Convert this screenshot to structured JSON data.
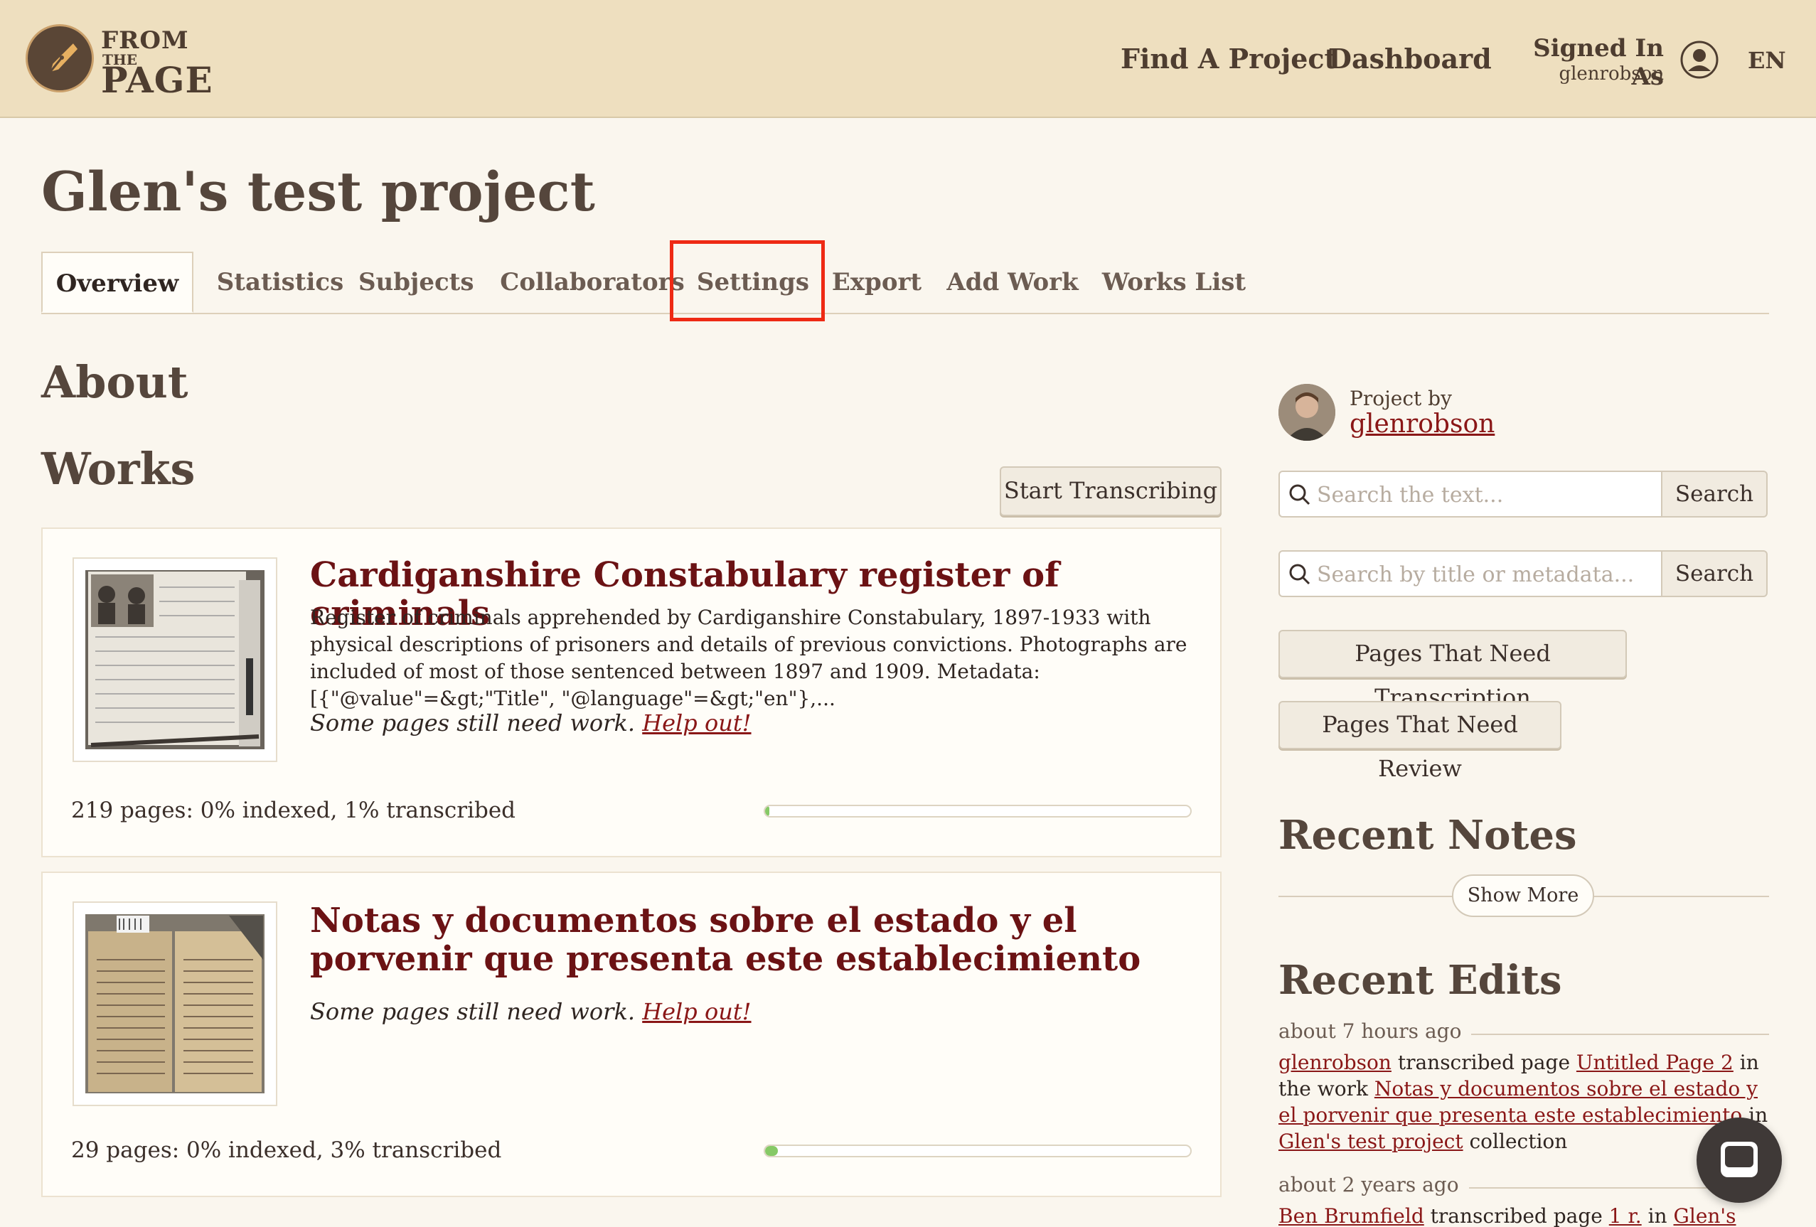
{
  "header": {
    "logo": {
      "line1": "FROM",
      "line2": "THE",
      "line3": "PAGE"
    },
    "nav": {
      "find_project": "Find A Project",
      "dashboard": "Dashboard"
    },
    "signed_in_label": "Signed In As",
    "username": "glenrobson",
    "language": "EN"
  },
  "page": {
    "title": "Glen's test project"
  },
  "tabs": [
    "Overview",
    "Statistics",
    "Subjects",
    "Collaborators",
    "Settings",
    "Export",
    "Add Work",
    "Works List"
  ],
  "active_tab": "Overview",
  "highlighted_tab": "Settings",
  "main": {
    "about_heading": "About",
    "works_heading": "Works",
    "start_button": "Start Transcribing",
    "works": [
      {
        "title": "Cardiganshire Constabulary register of criminals",
        "description": "Register of criminals apprehended by Cardiganshire Constabulary, 1897-1933 with physical descriptions of prisoners and details of previous convictions. Photographs are included of most of those sentenced between 1897 and 1909. Metadata: [{\"@value\"=&gt;\"Title\", \"@language\"=&gt;\"en\"},...",
        "note": "Some pages still need work.",
        "help_link": "Help out!",
        "stats": "219 pages: 0% indexed, 1% transcribed",
        "progress": 0.01
      },
      {
        "title": "Notas y documentos sobre el estado y el porvenir que presenta este establecimiento",
        "description": "",
        "note": "Some pages still need work.",
        "help_link": "Help out!",
        "stats": "29 pages: 0% indexed, 3% transcribed",
        "progress": 0.03
      }
    ]
  },
  "sidebar": {
    "project_by": "Project by",
    "owner": "glenrobson",
    "search_text": {
      "placeholder": "Search the text...",
      "button": "Search"
    },
    "search_meta": {
      "placeholder": "Search by title or metadata...",
      "button": "Search"
    },
    "buttons": [
      "Pages That Need Transcription",
      "Pages That Need Review"
    ],
    "recent_notes_heading": "Recent Notes",
    "show_more": "Show More",
    "recent_edits_heading": "Recent Edits",
    "edits": [
      {
        "time": "about 7 hours ago",
        "user": "glenrobson",
        "action": "transcribed page",
        "page": "Untitled Page 2",
        "in_work": "in the work",
        "work": "Notas y documentos sobre el estado y el porvenir que presenta este establecimiento",
        "in": "in",
        "collection": "Glen's test project",
        "suffix": "collection"
      },
      {
        "time": "about 2 years ago",
        "user": "Ben Brumfield",
        "action": "transcribed page",
        "page": "1 r.",
        "in": "in",
        "collection": "Glen's test"
      }
    ]
  },
  "colors": {
    "accent": "#6b1214",
    "header_bg": "#eedfbf",
    "highlight": "#ee2a14",
    "progress": "#86c966"
  }
}
